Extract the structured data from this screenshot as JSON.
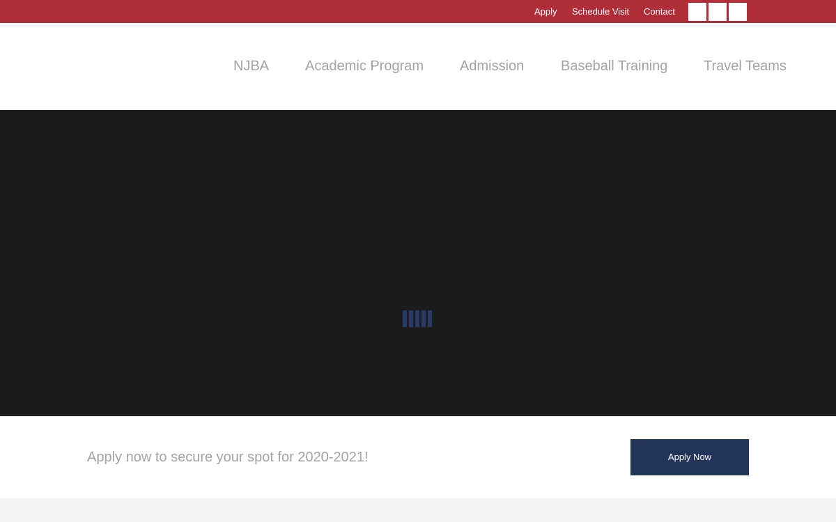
{
  "colors": {
    "topbar_bg": "#b02d37",
    "nav_text": "#a3a3a3",
    "hero_bg": "#1c1c1c",
    "loader": "#2a3a66",
    "button_bg": "#24355c",
    "footer_bg": "#f5f5f5"
  },
  "topbar": {
    "links": [
      {
        "label": "Apply"
      },
      {
        "label": "Schedule Visit"
      },
      {
        "label": "Contact"
      }
    ],
    "social_icons": [
      "social-icon-1",
      "social-icon-2",
      "social-icon-3"
    ]
  },
  "nav": {
    "items": [
      {
        "label": "NJBA"
      },
      {
        "label": "Academic Program"
      },
      {
        "label": "Admission"
      },
      {
        "label": "Baseball Training"
      },
      {
        "label": "Travel Teams"
      }
    ]
  },
  "hero": {
    "loader_icon": "loading-bars-icon"
  },
  "cta": {
    "text": "Apply now to secure your spot for 2020-2021!",
    "button_label": "Apply Now"
  }
}
